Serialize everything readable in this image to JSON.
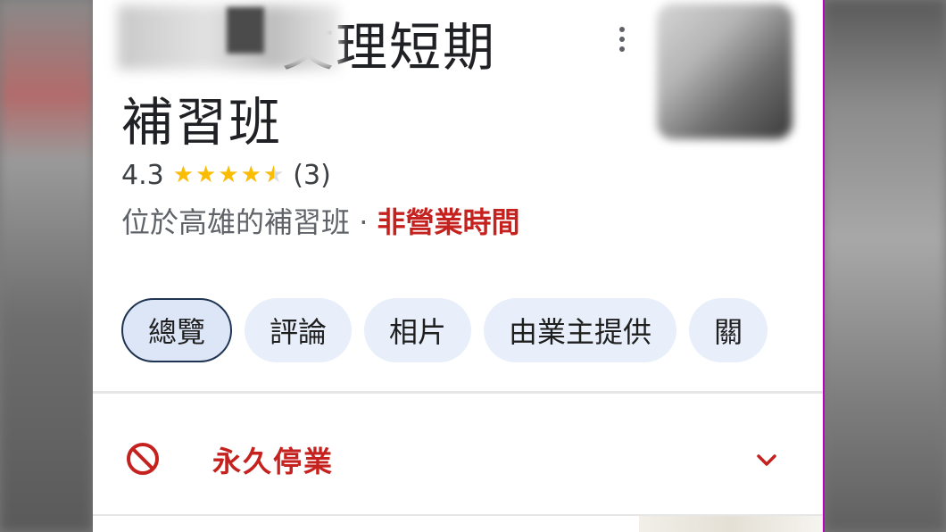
{
  "place": {
    "title_line1_visible": "文理短期",
    "title_line2": "補習班",
    "rating": "4.3",
    "stars": 4.3,
    "review_count": "(3)",
    "category": "位於高雄的補習班",
    "separator": " · ",
    "status": "非營業時間"
  },
  "tabs": [
    {
      "label": "總覽"
    },
    {
      "label": "評論"
    },
    {
      "label": "相片"
    },
    {
      "label": "由業主提供"
    },
    {
      "label": "關"
    }
  ],
  "closed_row": {
    "label": "永久停業"
  },
  "colors": {
    "status_red": "#c5221f",
    "star_yellow": "#fbbc04",
    "chip_bg": "#e8effa",
    "frame_border": "#c000c0"
  },
  "icons": [
    "more-vert-icon",
    "star-icon",
    "block-icon",
    "chevron-down-icon"
  ]
}
